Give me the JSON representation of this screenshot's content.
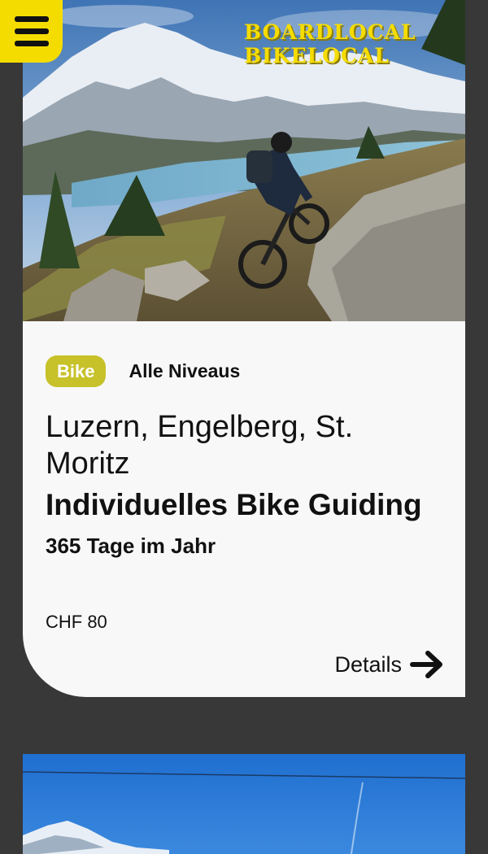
{
  "header": {
    "menu_icon": "hamburger-menu-icon",
    "brand_line1": "BOARDLOCAL",
    "brand_line2": "BIKELOCAL",
    "brand_color": "#f5dc00"
  },
  "card": {
    "image_alt": "",
    "category": "Bike",
    "level": "Alle Niveaus",
    "location": "Luzern, Engelberg, St. Moritz",
    "title": "Individuelles Bike Guiding",
    "availability": "365 Tage im Jahr",
    "price": "CHF 80",
    "details_label": "Details",
    "details_icon": "arrow-right-icon",
    "category_color": "#c7c12a"
  }
}
